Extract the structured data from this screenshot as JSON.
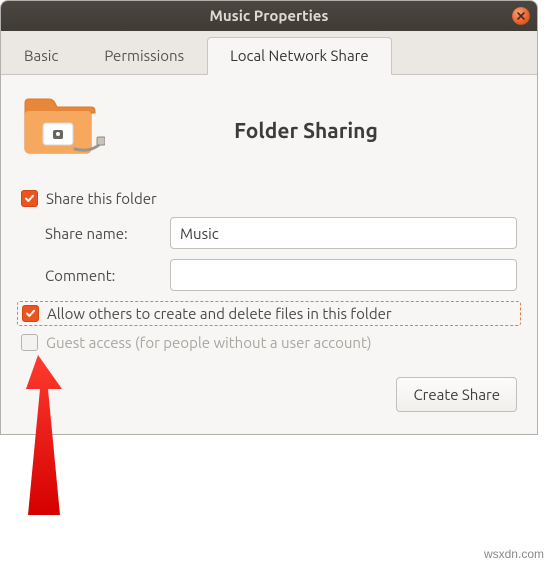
{
  "window": {
    "title": "Music Properties"
  },
  "tabs": {
    "basic": "Basic",
    "permissions": "Permissions",
    "share": "Local Network Share"
  },
  "panel": {
    "heading": "Folder Sharing",
    "share_checkbox": "Share this folder",
    "share_name_label": "Share name:",
    "share_name_value": "Music",
    "comment_label": "Comment:",
    "comment_value": "",
    "allow_others": "Allow others to create and delete files in this folder",
    "guest_access": "Guest access (for people without a user account)",
    "create_button": "Create Share"
  },
  "watermark": "wsxdn.com"
}
